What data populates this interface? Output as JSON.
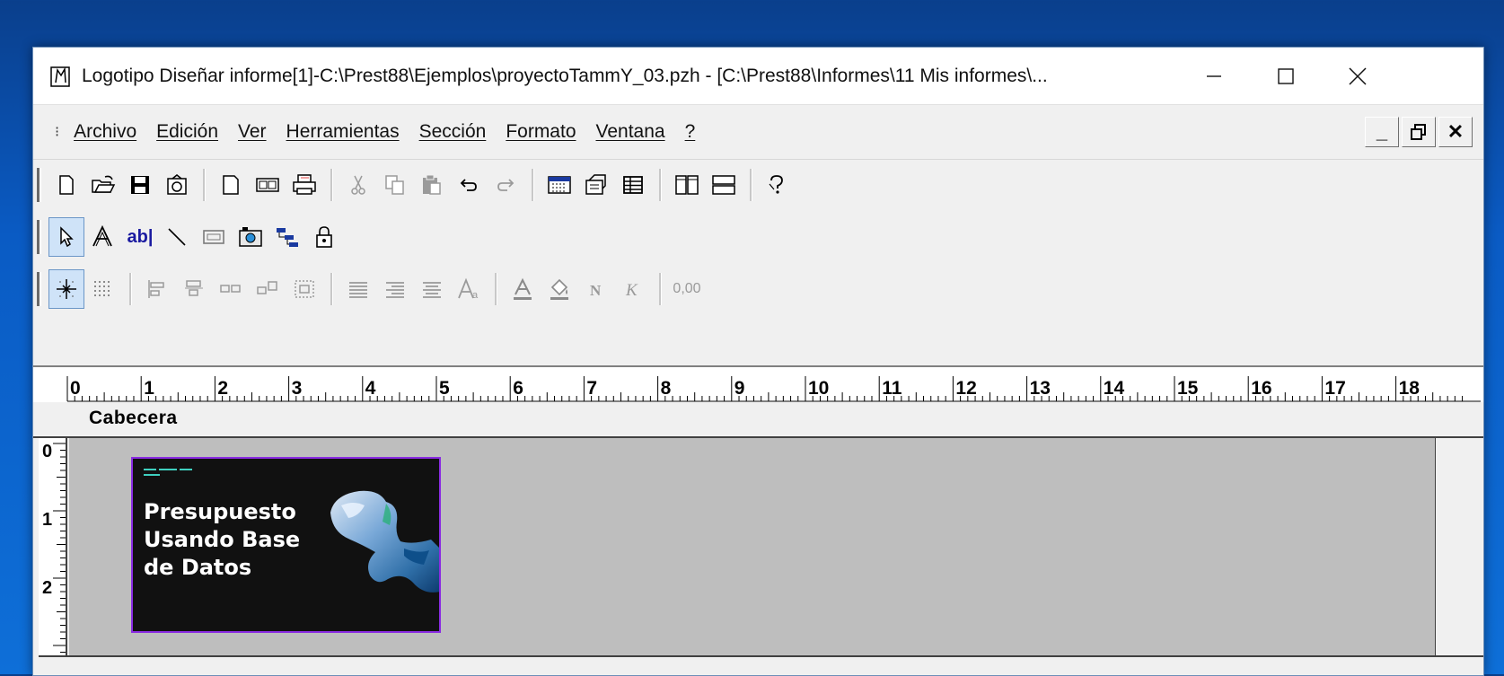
{
  "window": {
    "title": "Logotipo Diseñar informe[1]-C:\\Prest88\\Ejemplos\\proyectoTammY_03.pzh - [C:\\Prest88\\Informes\\11 Mis informes\\...",
    "controls": {
      "minimize": "—",
      "maximize": "☐",
      "close": "✕"
    }
  },
  "menubar": {
    "system_glyph": "⁝",
    "items": [
      "Archivo",
      "Edición",
      "Ver",
      "Herramientas",
      "Sección",
      "Formato",
      "Ventana",
      "?"
    ],
    "mdi_controls": {
      "minimize": "_",
      "restore": "🗗",
      "close": "✕"
    }
  },
  "toolbars": {
    "standard": [
      "new-document-icon",
      "open-folder-icon",
      "save-icon",
      "save-as-icon",
      "new-page-icon",
      "preview-icon",
      "print-icon",
      "cut-icon",
      "copy-icon",
      "paste-icon",
      "undo-icon",
      "redo-icon",
      "calendar-icon",
      "properties-icon",
      "table-icon",
      "columns-icon",
      "rows-icon",
      "help-icon"
    ],
    "tools": {
      "items": [
        "pointer-icon",
        "text-style-icon",
        "text-field-icon",
        "line-icon",
        "rectangle-icon",
        "image-icon",
        "hierarchy-icon",
        "lock-icon"
      ],
      "text_field_label": "ab|"
    },
    "format": {
      "items": [
        "snap-grid-icon",
        "show-grid-icon",
        "align-left-icon",
        "align-top-icon",
        "same-width-icon",
        "same-height-icon",
        "distribute-icon",
        "text-left-icon",
        "text-right-icon",
        "text-center-icon",
        "font-icon",
        "underline-font-icon",
        "fill-icon",
        "bold-icon",
        "italic-icon",
        "number-format-icon"
      ],
      "number_format_label": "0,00"
    }
  },
  "ruler": {
    "numbers": [
      "0",
      "1",
      "2",
      "3",
      "4",
      "5",
      "6",
      "7",
      "8",
      "9",
      "10",
      "11",
      "12",
      "13",
      "14",
      "15",
      "16",
      "17",
      "18"
    ]
  },
  "section": {
    "label": "Cabecera",
    "vertical_ruler": [
      "0",
      "1",
      "2"
    ]
  },
  "logo": {
    "title_lines": [
      "Presupuesto",
      "Usando Base",
      "de Datos"
    ]
  },
  "colors": {
    "desktop": "#0a5bc4",
    "section_body": "#bebebe",
    "selection_border": "#8a2be2",
    "logo_background": "#111111",
    "logo_accent": "#3fd0c0"
  }
}
